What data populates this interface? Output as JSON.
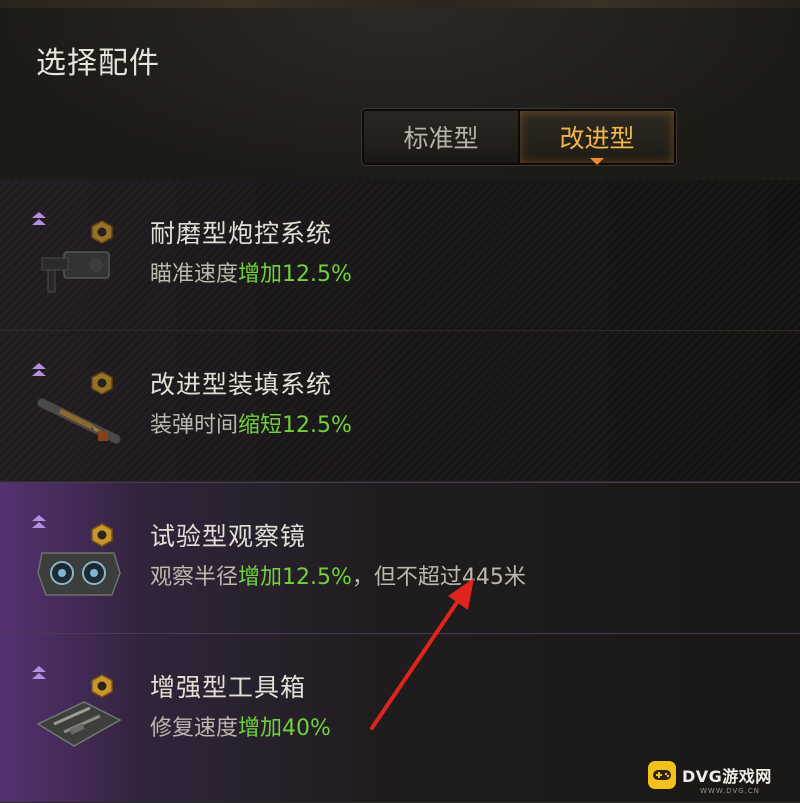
{
  "dialog": {
    "title": "选择配件"
  },
  "tabs": [
    {
      "label": "标准型",
      "active": false
    },
    {
      "label": "改进型",
      "active": true
    }
  ],
  "items": [
    {
      "name": "耐磨型炮控系统",
      "effect_prefix": "瞄准速度",
      "effect_value": "增加12.5%",
      "effect_suffix": "",
      "icon": "gun-control-icon"
    },
    {
      "name": "改进型装填系统",
      "effect_prefix": "装弹时间",
      "effect_value": "缩短12.5%",
      "effect_suffix": "",
      "icon": "loader-shell-icon"
    },
    {
      "name": "试验型观察镜",
      "effect_prefix": "观察半径",
      "effect_value": "增加12.5%",
      "effect_suffix": "，但不超过445米",
      "icon": "binoculars-icon"
    },
    {
      "name": "增强型工具箱",
      "effect_prefix": "修复速度",
      "effect_value": "增加40%",
      "effect_suffix": "",
      "icon": "toolbox-icon"
    }
  ],
  "colors": {
    "accent": "#f0b64a",
    "positive": "#6fd23a",
    "rank": "#b58ee0",
    "annotation_arrow": "#e0231c"
  },
  "watermark": {
    "brand": "DVG游戏网",
    "url": "WWW.DVG.CN"
  }
}
